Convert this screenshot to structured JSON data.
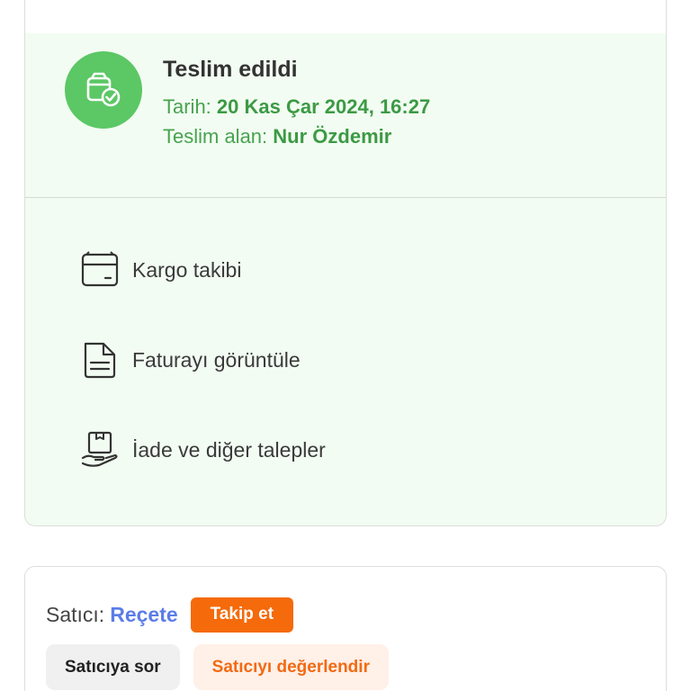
{
  "delivery": {
    "status_title": "Teslim edildi",
    "date_label": "Tarih:",
    "date_value": "20 Kas Çar 2024, 16:27",
    "receiver_label": "Teslim alan:",
    "receiver_value": "Nur Özdemir",
    "status_icon": "package-check-icon"
  },
  "actions": [
    {
      "label": "Kargo takibi",
      "icon": "box-icon"
    },
    {
      "label": "Faturayı görüntüle",
      "icon": "document-icon"
    },
    {
      "label": "İade ve diğer talepler",
      "icon": "return-hand-icon"
    }
  ],
  "seller": {
    "prefix": "Satıcı:",
    "name": "Reçete",
    "follow_label": "Takip et",
    "ask_label": "Satıcıya sor",
    "rate_label": "Satıcıyı değerlendir"
  },
  "colors": {
    "status_green": "#5cc765",
    "success_text": "#3c9a44",
    "panel_bg": "#f2fcf2",
    "accent_orange": "#f56a0a",
    "link_blue": "#5b7de8"
  }
}
